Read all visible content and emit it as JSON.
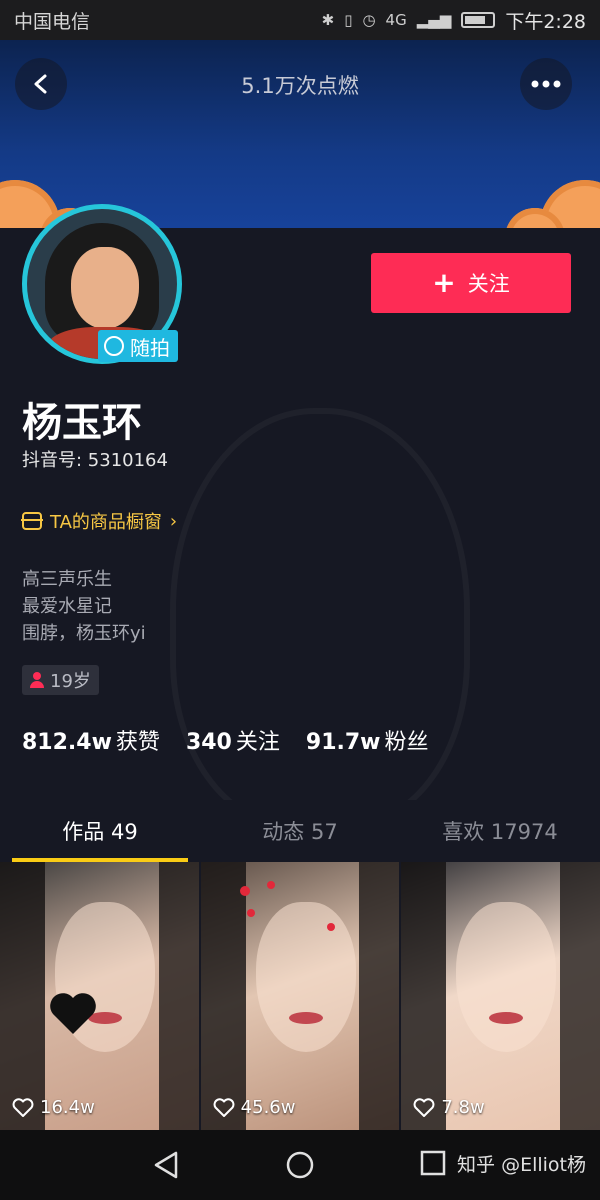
{
  "status_bar": {
    "carrier": "中国电信",
    "network": "4G",
    "time": "下午2:28"
  },
  "header": {
    "title": "5.1万次点燃",
    "back_icon": "chevron-left-icon",
    "more_icon": "more-dots-icon"
  },
  "profile": {
    "badge_label": "随拍",
    "follow_label": "关注",
    "name": "杨玉环",
    "douyin_id": "抖音号: 5310164",
    "shop_label": "TA的商品橱窗",
    "bio": [
      "高三声乐生",
      "最爱水星记",
      "围脖，杨玉环yi"
    ],
    "age": "19岁",
    "stats": [
      {
        "num": "812.4w",
        "label": "获赞"
      },
      {
        "num": "340",
        "label": "关注"
      },
      {
        "num": "91.7w",
        "label": "粉丝"
      }
    ]
  },
  "tabs": [
    {
      "label": "作品 49",
      "active": true
    },
    {
      "label": "动态 57",
      "active": false
    },
    {
      "label": "喜欢 17974",
      "active": false
    }
  ],
  "videos": [
    {
      "likes": "16.4w"
    },
    {
      "likes": "45.6w"
    },
    {
      "likes": "7.8w"
    }
  ],
  "nav": {
    "back_icon": "triangle-back-icon",
    "home_icon": "circle-home-icon",
    "recents_icon": "square-recents-icon",
    "watermark": "知乎 @Elliot杨"
  },
  "colors": {
    "accent_red": "#fe2c55",
    "tab_indicator": "#facc15",
    "shop_yellow": "#f7c744",
    "avatar_ring": "#26c6da"
  }
}
